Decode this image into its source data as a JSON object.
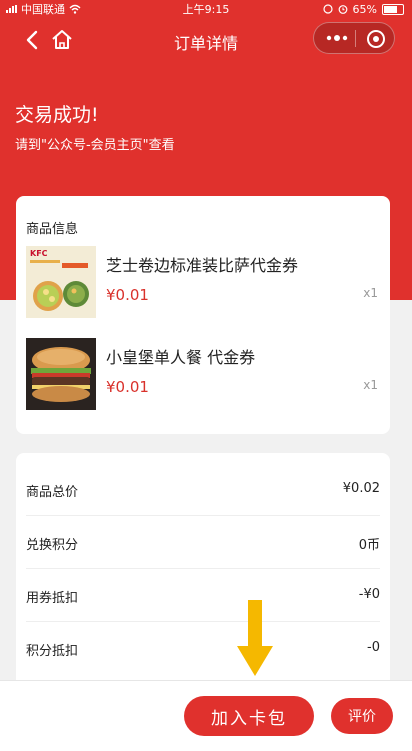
{
  "status_bar": {
    "carrier": "中国联通",
    "time": "上午9:15",
    "battery": "65%"
  },
  "nav": {
    "title": "订单详情",
    "back_icon": "chevron-left-icon",
    "home_icon": "home-icon",
    "more_icon": "more-dots-icon",
    "close_icon": "target-close-icon"
  },
  "order_status": {
    "title": "交易成功!",
    "subtitle": "请到\"公众号-会员主页\"查看"
  },
  "goods": {
    "section_label": "商品信息",
    "items": [
      {
        "name": "芝士卷边标准装比萨代金券",
        "price": "¥0.01",
        "qty": "x1",
        "thumb_text": "KFC"
      },
      {
        "name": "小皇堡单人餐 代金券",
        "price": "¥0.01",
        "qty": "x1"
      }
    ]
  },
  "summary": {
    "rows": [
      {
        "label": "商品总价",
        "value": "¥0.02"
      },
      {
        "label": "兑换积分",
        "value": "0币"
      },
      {
        "label": "用券抵扣",
        "value": "-¥0"
      },
      {
        "label": "积分抵扣",
        "value": "-0"
      }
    ]
  },
  "actions": {
    "add_to_wallet": "加入卡包",
    "review": "评价"
  },
  "colors": {
    "brand_red": "#e0312d",
    "price_red": "#d9312b",
    "arrow_yellow": "#f5b800"
  }
}
